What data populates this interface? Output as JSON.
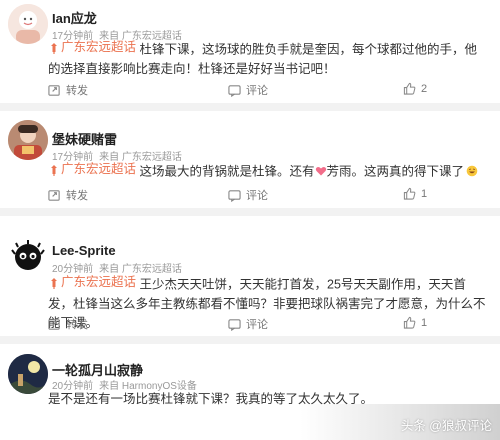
{
  "topic_label": "广东宏远超话",
  "actions": {
    "forward": "转发",
    "comment": "评论"
  },
  "posts": [
    {
      "username": "Ian应龙",
      "time": "17分钟前",
      "source": "来自 广东宏远超话",
      "text": "杜锋下课，这场球的胜负手就是奎因，每个球都过他的手，他的选择直接影响比赛走向！杜锋还是好好当书记吧！",
      "likes": "2"
    },
    {
      "username": "堡妹硬赌雷",
      "time": "17分钟前",
      "source": "来自 广东宏远超话",
      "text_a": "这场最大的背锅就是杜锋。还有",
      "text_b": "芳雨。这两真的得下课了",
      "likes": "1"
    },
    {
      "username": "Lee-Sprite",
      "time": "20分钟前",
      "source": "来自 广东宏远超话",
      "text": "王少杰天天吐饼，天天能打首发，25号天天副作用，天天首发，杜锋当这么多年主教练都看不懂吗？非要把球队祸害完了才愿意，为什么不能下课。",
      "likes": "1"
    },
    {
      "username": "一轮孤月山寂静",
      "time": "20分钟前",
      "source": "来自 HarmonyOS设备",
      "text": "是不是还有一场比赛杜锋就下课？我真的等了太久太久了。"
    }
  ],
  "watermark": "头条 @狼叔评论",
  "colors": {
    "topic": "#eb7350",
    "separator": "#f2f2f2"
  }
}
